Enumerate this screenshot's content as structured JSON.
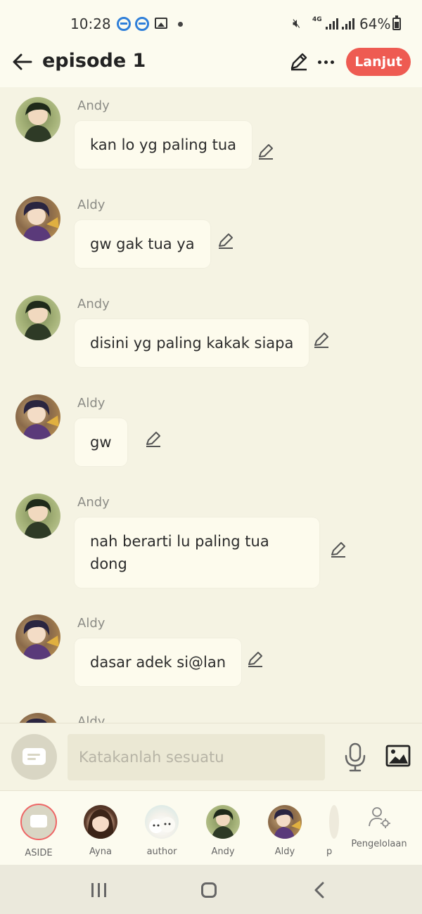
{
  "status_bar": {
    "time": "10:28",
    "network": "4G",
    "battery": "64%",
    "icons": [
      "s-icon",
      "s-icon",
      "gallery-icon",
      "mute-icon",
      "signal-icon",
      "battery-icon"
    ]
  },
  "header": {
    "title": "episode 1",
    "next_label": "Lanjut",
    "accent_color": "#ee5b52"
  },
  "chat": {
    "messages": [
      {
        "sender": "Andy",
        "text": "kan lo yg paling tua"
      },
      {
        "sender": "Aldy",
        "text": "gw gak tua ya"
      },
      {
        "sender": "Andy",
        "text": "disini yg paling kakak siapa"
      },
      {
        "sender": "Aldy",
        "text": "gw"
      },
      {
        "sender": "Andy",
        "text": "nah berarti lu paling tua dong"
      },
      {
        "sender": "Aldy",
        "text": "dasar adek si@lan"
      },
      {
        "sender": "Aldy",
        "text": ""
      }
    ]
  },
  "composer": {
    "placeholder": "Katakanlah sesuatu"
  },
  "characters": {
    "items": [
      {
        "name": "ASIDE"
      },
      {
        "name": "Ayna"
      },
      {
        "name": "author"
      },
      {
        "name": "Andy"
      },
      {
        "name": "Aldy"
      },
      {
        "name": "p"
      }
    ],
    "manage_label": "Pengelolaan"
  }
}
